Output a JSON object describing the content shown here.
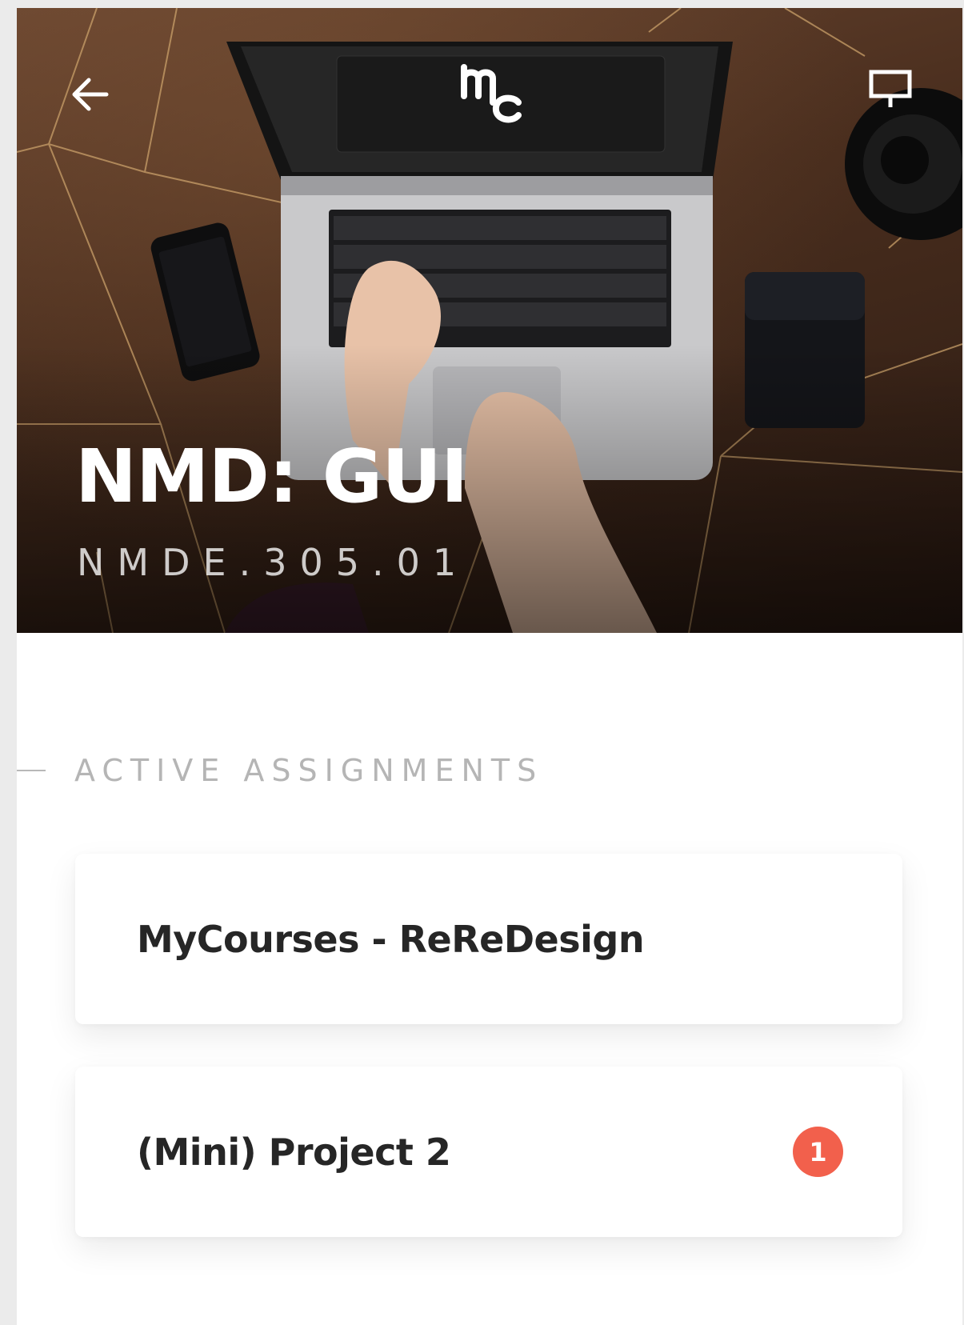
{
  "header": {
    "back_icon": "arrow-left-icon",
    "logo_icon": "mc-logo-icon",
    "present_icon": "presentation-screen-icon"
  },
  "course": {
    "title": "NMD: GUI",
    "code": "NMDE.305.01"
  },
  "assignments": {
    "section_title": "ACTIVE ASSIGNMENTS",
    "items": [
      {
        "title": "MyCourses - ReReDesign"
      },
      {
        "title": "(Mini) Project 2",
        "badge": "1"
      }
    ]
  },
  "colors": {
    "badge": "#f2604c",
    "card_text": "#262626",
    "section_text": "#b5b5b5"
  }
}
